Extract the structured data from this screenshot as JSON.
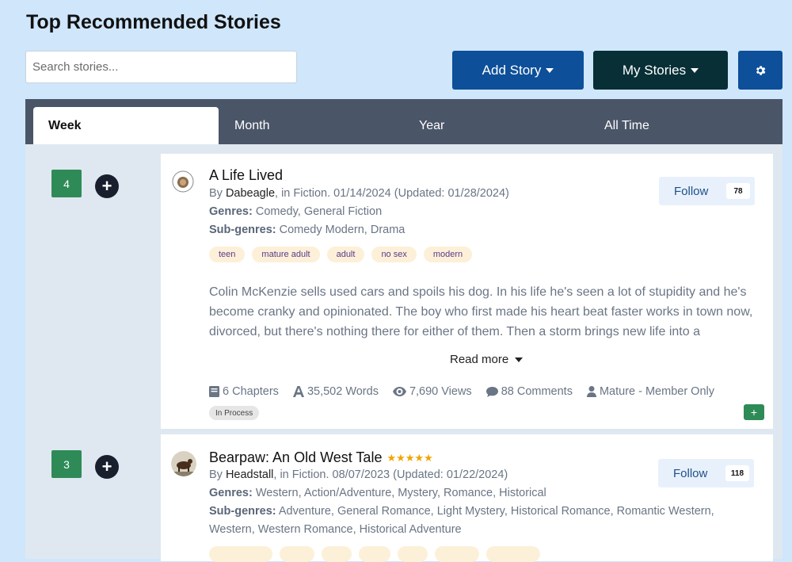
{
  "page": {
    "title": "Top Recommended Stories"
  },
  "search": {
    "placeholder": "Search stories..."
  },
  "toolbar": {
    "add_story_label": "Add Story",
    "my_stories_label": "My Stories"
  },
  "tabs": [
    {
      "label": "Week",
      "active": true
    },
    {
      "label": "Month",
      "active": false
    },
    {
      "label": "Year",
      "active": false
    },
    {
      "label": "All Time",
      "active": false
    }
  ],
  "stories": [
    {
      "rank": "4",
      "title": "A Life Lived",
      "by_prefix": "By ",
      "author": "Dabeagle",
      "published": ", in Fiction. 01/14/2024 (Updated: 01/28/2024)",
      "genres_label": "Genres:",
      "genres": "Comedy, General Fiction",
      "subgenres_label": "Sub-genres:",
      "subgenres": "Comedy Modern, Drama",
      "tags": [
        "teen",
        "mature adult",
        "adult",
        "no sex",
        "modern"
      ],
      "description": "Colin McKenzie sells used cars and spoils his dog. In his life he's seen a lot of stupidity and he's become cranky and opinionated. The boy who first made his heart beat faster works in town now, divorced, but there's nothing there for either of them. Then a storm brings new life into a",
      "read_more": "Read more",
      "follow_label": "Follow",
      "follow_count": "78",
      "stats": {
        "chapters": "6 Chapters",
        "words": "35,502 Words",
        "views": "7,690 Views",
        "comments": "88 Comments",
        "rating": "Mature - Member Only"
      },
      "status": "In Process",
      "add_label": "+"
    },
    {
      "rank": "3",
      "title": "Bearpaw: An Old West Tale",
      "stars": "★★★★★",
      "by_prefix": "By ",
      "author": "Headstall",
      "published": ", in Fiction. 08/07/2023 (Updated: 01/22/2024)",
      "genres_label": "Genres:",
      "genres": "Western, Action/Adventure, Mystery, Romance, Historical",
      "subgenres_label": "Sub-genres:",
      "subgenres": "Adventure, General Romance, Light Mystery, Historical Romance, Romantic Western,",
      "subgenres_line2": "Western, Western Romance, Historical Adventure",
      "follow_label": "Follow",
      "follow_count": "118"
    }
  ],
  "colors": {
    "background": "#cfe6fb",
    "primary": "#0d4f99",
    "dark": "#082f36",
    "rank": "#2e8b57",
    "tabbar": "#4a5568"
  }
}
